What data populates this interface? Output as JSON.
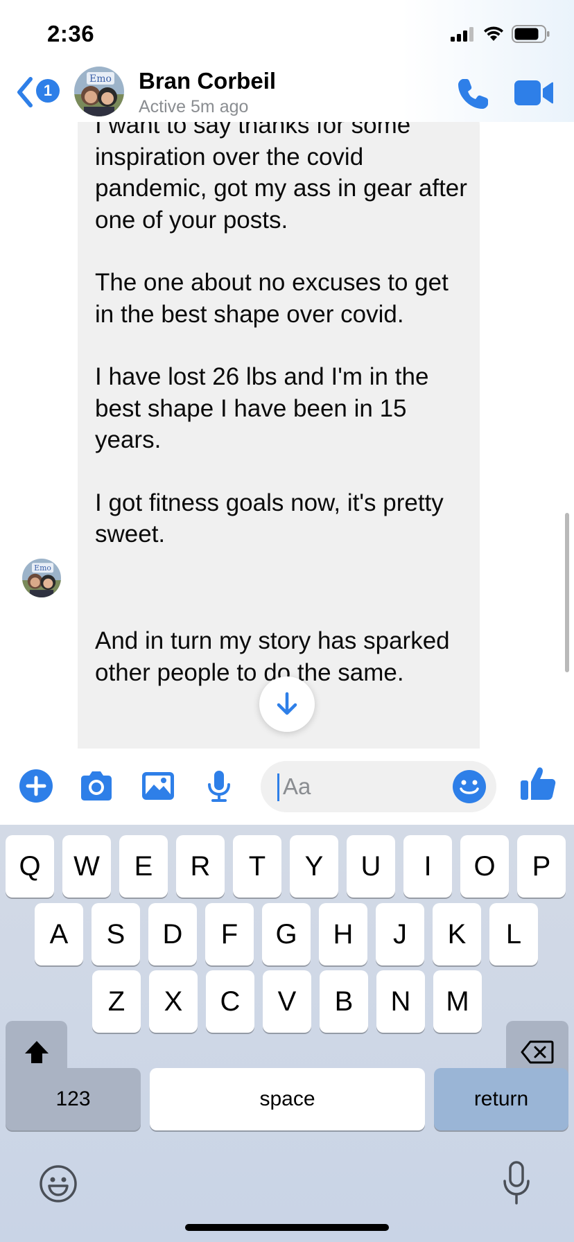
{
  "status_bar": {
    "time": "2:36",
    "icons": [
      "cellular-signal-icon",
      "wifi-icon",
      "battery-icon"
    ]
  },
  "header": {
    "back_badge": "1",
    "contact_name": "Bran Corbeil",
    "contact_status": "Active 5m ago",
    "actions": [
      "phone-icon",
      "video-camera-icon"
    ]
  },
  "messages": [
    {
      "sender": "Bran Corbeil",
      "paragraphs": [
        "I want to say thanks for some inspiration over the covid pandemic,  got my ass in gear after one of your posts.",
        "The one about no excuses to get in the best shape over covid.",
        "I have lost 26 lbs and I'm in the best shape I have been in 15 years.",
        "I got fitness goals now, it's pretty sweet."
      ]
    },
    {
      "sender": "Bran Corbeil",
      "paragraphs": [
        "And in turn my story has sparked other people to do the same."
      ]
    }
  ],
  "composer": {
    "placeholder": "Aa",
    "actions": [
      "plus-icon",
      "camera-icon",
      "gallery-icon",
      "microphone-icon",
      "emoji-icon",
      "thumbs-up-icon"
    ]
  },
  "keyboard": {
    "row1": [
      "Q",
      "W",
      "E",
      "R",
      "T",
      "Y",
      "U",
      "I",
      "O",
      "P"
    ],
    "row2": [
      "A",
      "S",
      "D",
      "F",
      "G",
      "H",
      "J",
      "K",
      "L"
    ],
    "row3": [
      "Z",
      "X",
      "C",
      "V",
      "B",
      "N",
      "M"
    ],
    "numbers_label": "123",
    "space_label": "space",
    "return_label": "return"
  },
  "colors": {
    "accent": "#2e7fe8",
    "bubble": "#f0f0f0",
    "keyboard_bg": "#d3dae6",
    "return_key": "#9ab5d6"
  }
}
